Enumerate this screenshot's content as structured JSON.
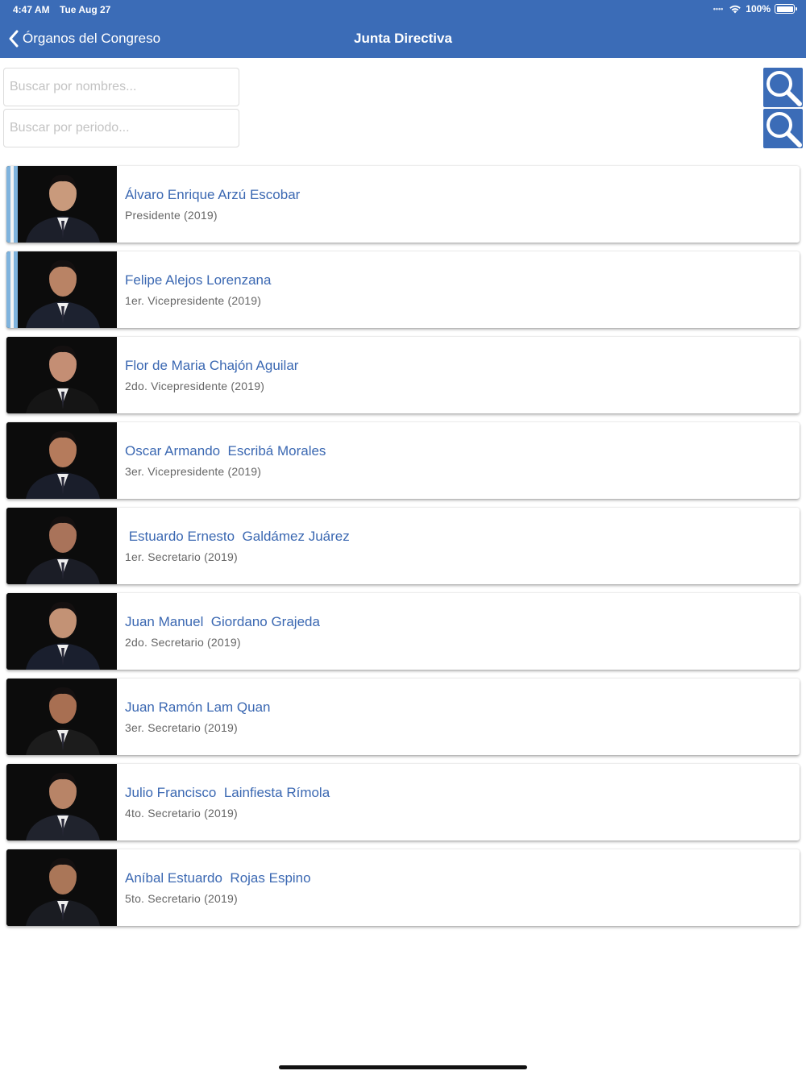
{
  "status_bar": {
    "time": "4:47 AM",
    "date": "Tue Aug 27",
    "battery": "100%"
  },
  "nav": {
    "back_label": "Órganos del Congreso",
    "title": "Junta Directiva"
  },
  "search": {
    "names_placeholder": "Buscar por nombres...",
    "period_placeholder": "Buscar por periodo..."
  },
  "members": [
    {
      "name": "Álvaro Enrique Arzú Escobar",
      "role": "Presidente (2019)"
    },
    {
      "name": "Felipe Alejos Lorenzana",
      "role": "1er. Vicepresidente (2019)"
    },
    {
      "name": "Flor de Maria Chajón Aguilar",
      "role": "2do. Vicepresidente (2019)"
    },
    {
      "name": "Oscar Armando  Escribá Morales",
      "role": "3er. Vicepresidente (2019)"
    },
    {
      "name": " Estuardo Ernesto  Galdámez Juárez",
      "role": "1er. Secretario (2019)"
    },
    {
      "name": "Juan Manuel  Giordano Grajeda",
      "role": "2do. Secretario (2019)"
    },
    {
      "name": "Juan Ramón Lam Quan",
      "role": "3er. Secretario (2019)"
    },
    {
      "name": "Julio Francisco  Lainfiesta Rímola",
      "role": "4to. Secretario (2019)"
    },
    {
      "name": "Aníbal Estuardo  Rojas Espino",
      "role": "5to. Secretario (2019)"
    }
  ],
  "colors": {
    "nav_bar": "#3b6cb7",
    "link_text": "#3b68b2",
    "role_text": "#666666"
  }
}
